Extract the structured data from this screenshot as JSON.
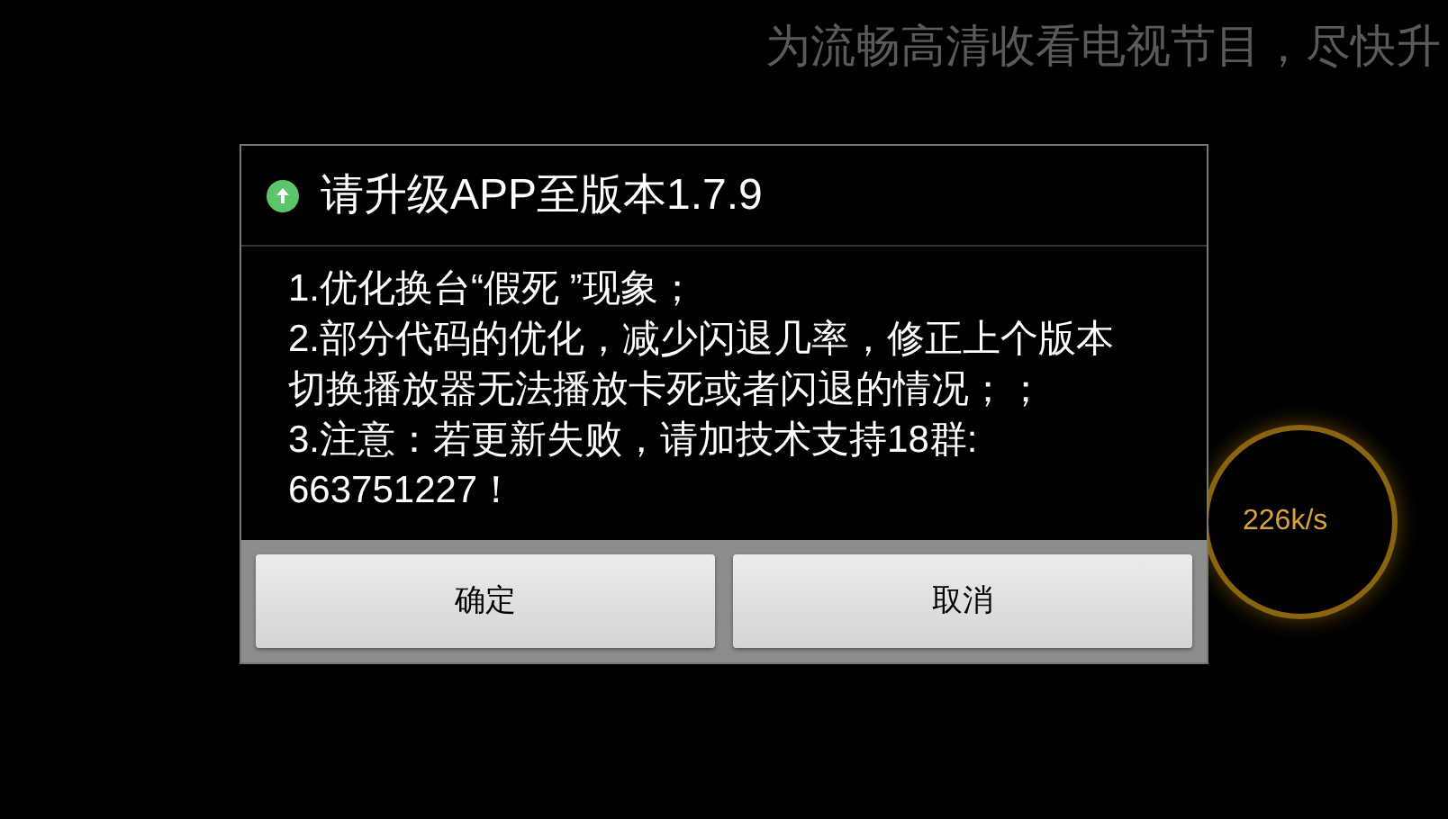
{
  "banner": "为流畅高清收看电视节目，尽快升",
  "speed_meter": {
    "reading": "226k/s"
  },
  "dialog": {
    "title": "请升级APP至版本1.7.9",
    "notes": [
      "1.优化换台“假死 ”现象；",
      "2.部分代码的优化，减少闪退几率，修正上个版本切换播放器无法播放卡死或者闪退的情况；；",
      "3.注意：若更新失败，请加技术支持18群: 663751227！"
    ],
    "buttons": [
      "确定",
      "取消"
    ]
  }
}
